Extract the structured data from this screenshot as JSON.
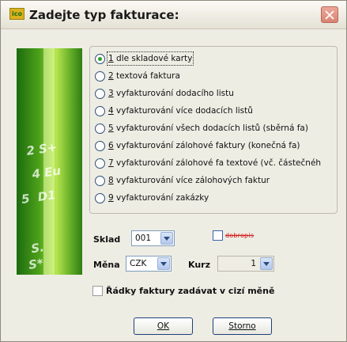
{
  "window": {
    "title": "Zadejte typ fakturace:",
    "app_icon": "ico"
  },
  "options": [
    {
      "num": "1",
      "text": " dle skladové karty",
      "checked": true
    },
    {
      "num": "2",
      "text": " textová faktura",
      "checked": false
    },
    {
      "num": "3",
      "text": " vyfakturování dodacího listu",
      "checked": false
    },
    {
      "num": "4",
      "text": " vyfakturování více dodacích listů",
      "checked": false
    },
    {
      "num": "5",
      "text": " vyfakturování všech dodacích listů (sběrná fa)",
      "checked": false
    },
    {
      "num": "6",
      "text": " vyfakturování zálohové faktury (konečná fa)",
      "checked": false
    },
    {
      "num": "7",
      "text": " vyfakturování zálohové fa textové (vč. částečnéh",
      "checked": false
    },
    {
      "num": "8",
      "text": " vyfakturování více zálohových faktur",
      "checked": false
    },
    {
      "num": "9",
      "text": " vyfakturování zakázky",
      "checked": false
    }
  ],
  "form": {
    "sklad_label": "Sklad",
    "sklad_value": "001",
    "dobropis_label": "dobropis",
    "mena_label": "Měna",
    "mena_value": "CZK",
    "kurz_label": "Kurz",
    "kurz_value": "1",
    "cizi_mena_label": "Řádky faktury zadávat v cizí měně"
  },
  "buttons": {
    "ok_label": "OK",
    "storno_label": "Storno"
  },
  "colors": {
    "accent_green": "#2ea02b",
    "dobropis_red": "#d11b1b"
  }
}
